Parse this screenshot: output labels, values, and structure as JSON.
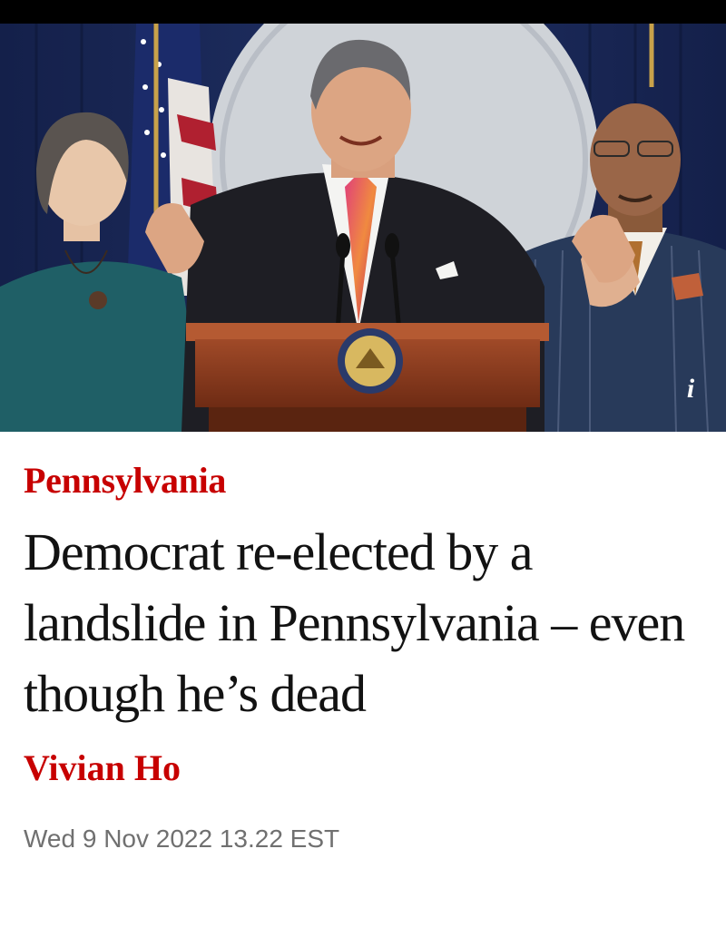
{
  "article": {
    "section": "Pennsylvania",
    "headline": "Democrat re-elected by a landslide in Pennsylvania – even though he’s dead",
    "author": "Vivian Ho",
    "date": "Wed 9 Nov 2022 13.22 EST"
  },
  "hero": {
    "info_glyph": "i"
  },
  "colors": {
    "section": "#c70000",
    "headline": "#121212",
    "date": "#707070",
    "podium": "#8b3b1f",
    "backdrop": "#1c2a55"
  },
  "icons": {
    "info": "info-icon",
    "seal": "state-seal-emblem"
  }
}
